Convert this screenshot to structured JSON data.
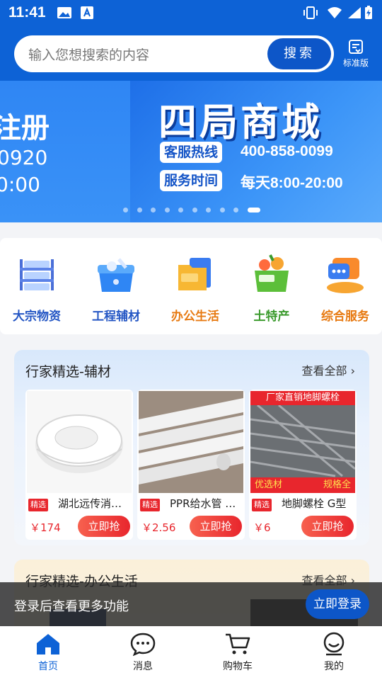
{
  "status_bar": {
    "time": "11:41"
  },
  "search": {
    "placeholder": "输入您想搜索的内容",
    "button": "搜索",
    "standard_label": "标准版"
  },
  "banner": {
    "left_title": "注册",
    "left_line1": "0920",
    "left_line2": "0:00",
    "brand": "四局商城",
    "hotline_label": "客服热线",
    "hotline_value": "400-858-0099",
    "hours_label": "服务时间",
    "hours_value": "每天8:00-20:00",
    "slide_count": 10,
    "active_slide": 10
  },
  "categories": [
    {
      "label": "大宗物资",
      "color": "#2456c4",
      "icon": "warehouse-icon"
    },
    {
      "label": "工程辅材",
      "color": "#2456c4",
      "icon": "toolbox-icon"
    },
    {
      "label": "办公生活",
      "color": "#e77a12",
      "icon": "folder-icon"
    },
    {
      "label": "土特产",
      "color": "#3a9a2c",
      "icon": "basket-icon"
    },
    {
      "label": "综合服务",
      "color": "#e77a12",
      "icon": "chat-service-icon"
    }
  ],
  "section1": {
    "title": "行家精选-辅材",
    "more": "查看全部",
    "products": [
      {
        "tag": "精选",
        "name": "湖北远传消防水带",
        "price": "￥174",
        "buy": "立即抢"
      },
      {
        "tag": "精选",
        "name": "PPR给水管 白色",
        "price": "￥2.56",
        "buy": "立即抢"
      },
      {
        "tag": "精选",
        "name": "地脚螺栓 G型",
        "price": "￥6",
        "buy": "立即抢",
        "img_top": "厂家直销地脚螺栓",
        "img_bottom_left": "优选材",
        "img_bottom_right": "规格全"
      }
    ]
  },
  "section2": {
    "title": "行家精选-办公生活",
    "more": "查看全部"
  },
  "toast": {
    "message": "登录后查看更多功能",
    "button": "立即登录"
  },
  "nav": [
    {
      "label": "首页",
      "active": true
    },
    {
      "label": "消息",
      "active": false
    },
    {
      "label": "购物车",
      "active": false
    },
    {
      "label": "我的",
      "active": false
    }
  ],
  "colors": {
    "brand_blue": "#0d62d6",
    "price_red": "#e8262d"
  }
}
